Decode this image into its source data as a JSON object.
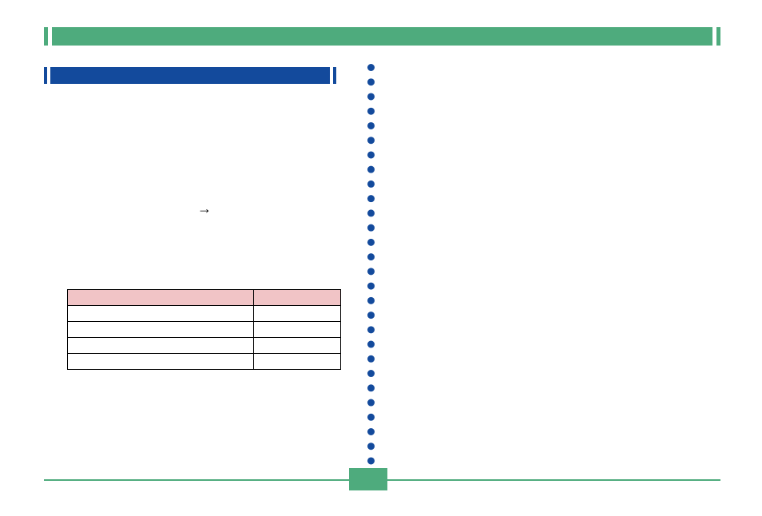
{
  "colors": {
    "green": "#4eab7d",
    "blue": "#134a9c",
    "tableHeader": "#f1c4c6"
  },
  "topBanner": {
    "title": ""
  },
  "leftColumn": {
    "subheader": "",
    "arrowGlyph": "→",
    "table": {
      "headers": [
        "",
        ""
      ],
      "rows": [
        [
          "",
          ""
        ],
        [
          "",
          ""
        ],
        [
          "",
          ""
        ],
        [
          "",
          ""
        ]
      ]
    }
  },
  "pageNumber": ""
}
